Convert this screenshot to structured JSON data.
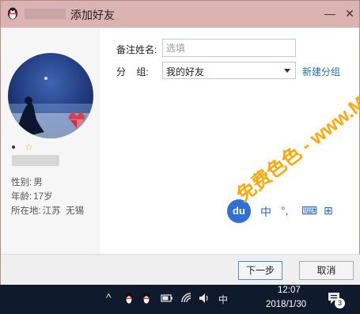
{
  "window": {
    "title": "添加好友",
    "controls": {
      "minimize": "—",
      "close": "✕"
    }
  },
  "profile": {
    "gender_label": "性别:",
    "gender_value": "男",
    "age_label": "年龄:",
    "age_value": "17岁",
    "location_label": "所在地:",
    "location_value": "江苏  无锡"
  },
  "form": {
    "remark_label": "备注姓名:",
    "remark_placeholder": "选填",
    "group_label": "分    组:",
    "group_value": "我的好友",
    "new_group_link": "新建分组"
  },
  "ime_toolbar": {
    "logo": "du",
    "lang": "中",
    "items": [
      "°,",
      "⌨",
      "⊞"
    ]
  },
  "buttons": {
    "next": "下一步",
    "cancel": "取消"
  },
  "taskbar": {
    "chevron": "^",
    "ime_lang": "中",
    "time": "12:07",
    "date": "2018/1/30",
    "notification_count": "3"
  },
  "watermark": {
    "text": "免费色色 - www.MFsese.com"
  },
  "colors": {
    "titlebar": "#dcb3b3",
    "link": "#1c6fbd",
    "watermark": "#ffa80a",
    "taskbar": "#0f1b2d"
  }
}
